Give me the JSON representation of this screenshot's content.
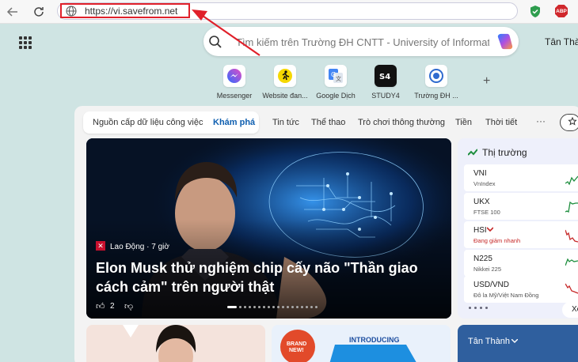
{
  "browser": {
    "url": "https://vi.savefrom.net",
    "extensions": {
      "abp_label": "ABP"
    }
  },
  "search": {
    "placeholder": "Tìm kiếm trên Trường ĐH CNTT - University of Information Technology"
  },
  "profile": {
    "name": "Tân Thành"
  },
  "quick_links": [
    {
      "label": "Messenger",
      "icon": "messenger-icon"
    },
    {
      "label": "Website đan...",
      "icon": "runner-icon"
    },
    {
      "label": "Google Dịch",
      "icon": "google-translate-icon"
    },
    {
      "label": "STUDY4",
      "icon": "study4-icon"
    },
    {
      "label": "Trường ĐH ...",
      "icon": "uit-icon"
    }
  ],
  "feed_tabs": {
    "pill_first": "Nguồn cấp dữ liệu công việc",
    "pill_active": "Khám phá",
    "others": [
      "Tin tức",
      "Thể thao",
      "Trò chơi thông thường",
      "Tiền",
      "Thời tiết"
    ],
    "more": "···"
  },
  "hero": {
    "source": "Lao Động · 7 giờ",
    "title": "Elon Musk thử nghiệm chip cấy não \"Thần giao cách cảm\" trên người thật",
    "likes": "2"
  },
  "market": {
    "title": "Thị trường",
    "rows": [
      {
        "name": "VNI",
        "sub": "VnIndex",
        "trend": "up"
      },
      {
        "name": "UKX",
        "sub": "FTSE 100",
        "trend": "up"
      },
      {
        "name": "HSI",
        "sub": "Đang giảm nhanh",
        "trend": "down"
      },
      {
        "name": "N225",
        "sub": "Nikkei 225",
        "trend": "up"
      },
      {
        "name": "USD/VND",
        "sub": "Đô la Mỹ/Việt Nam Đồng",
        "trend": "down"
      }
    ],
    "more_label": "Xe"
  },
  "cards": {
    "promo_badge": "BRAND NEW!",
    "promo_text": "INTRODUCING",
    "weather_name": "Tân Thành"
  },
  "colors": {
    "accent": "#0f5fb0",
    "highlight": "#e0202a",
    "down": "#c62828",
    "up": "#1e8e3e"
  }
}
